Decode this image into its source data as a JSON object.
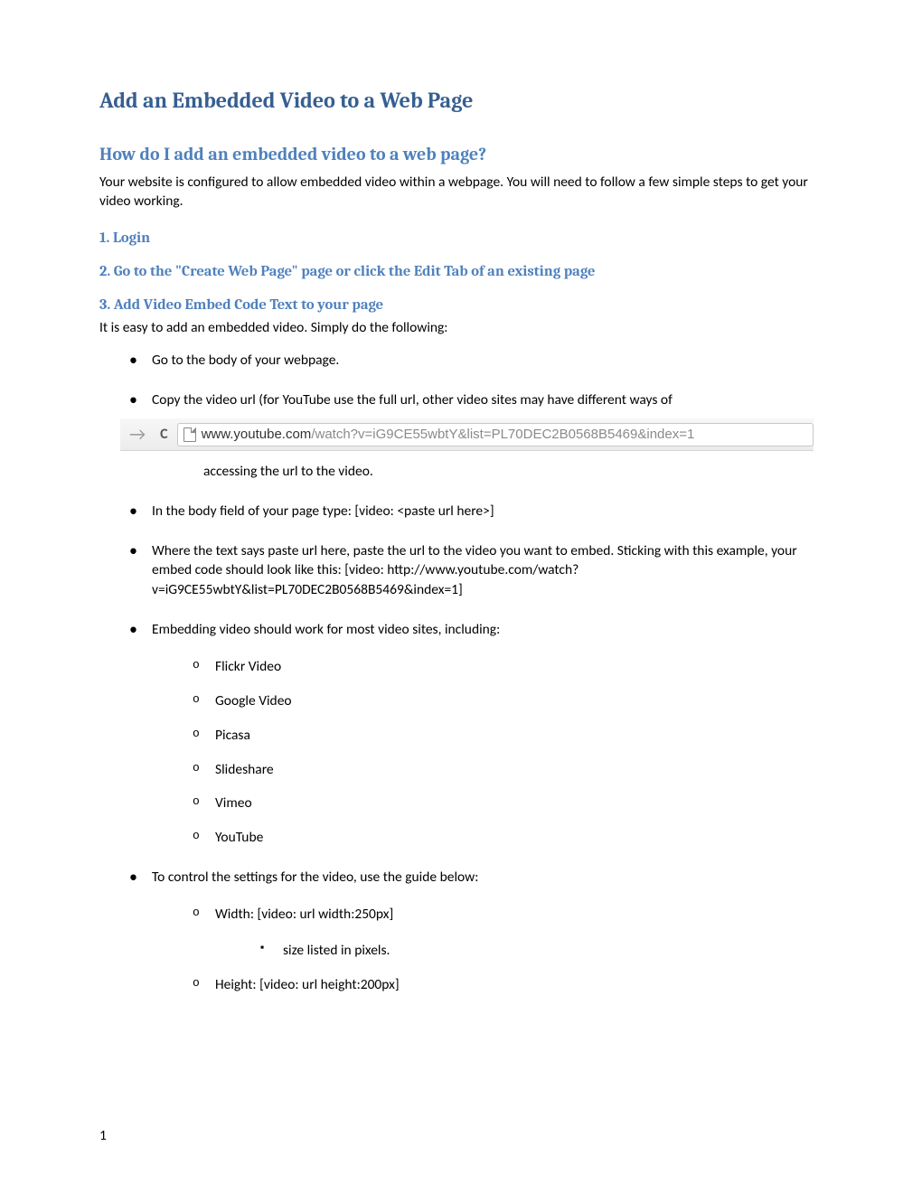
{
  "title": "Add an Embedded Video to a Web Page",
  "subtitle": "How do I add an embedded video to a web page?",
  "intro": "Your website is configured to allow embedded video within a webpage.  You will need to follow a few simple steps to get your video working.",
  "steps": {
    "s1": "1. Login",
    "s2": "2. Go to the \"Create Web Page\" page or click the Edit Tab of an existing page",
    "s3": "3. Add Video Embed Code Text to your page"
  },
  "step3_intro": "It is easy to add an embedded video. Simply do the following:",
  "bullets": {
    "b1": "Go to the body of your webpage.",
    "b2": "Copy the video url (for YouTube use the full url, other video sites may have different ways of",
    "b2b": "accessing the url to the video.",
    "b3": "In the body field of your page type: [video: <paste url here>]",
    "b4": "Where the text says paste url here, paste the url to the video you want to embed.  Sticking with this example, your embed code should look like this: [video: http://www.youtube.com/watch?v=iG9CE55wbtY&list=PL70DEC2B0568B5469&index=1]",
    "b5": "Embedding video should work for most video sites, including:",
    "b6": "To control the settings for the video, use the guide below:"
  },
  "sites": {
    "s1": "Flickr Video",
    "s2": "Google Video",
    "s3": "Picasa",
    "s4": "Slideshare",
    "s5": "Vimeo",
    "s6": "YouTube"
  },
  "settings": {
    "width": "Width: [video: url width:250px]",
    "width_sub": "size listed in pixels.",
    "height": "Height: [video: url height:200px]"
  },
  "url": {
    "domain": "www.youtube.com",
    "path": "/watch?v=iG9CE55wbtY&list=PL70DEC2B0568B5469&index=1"
  },
  "page_num": "1"
}
